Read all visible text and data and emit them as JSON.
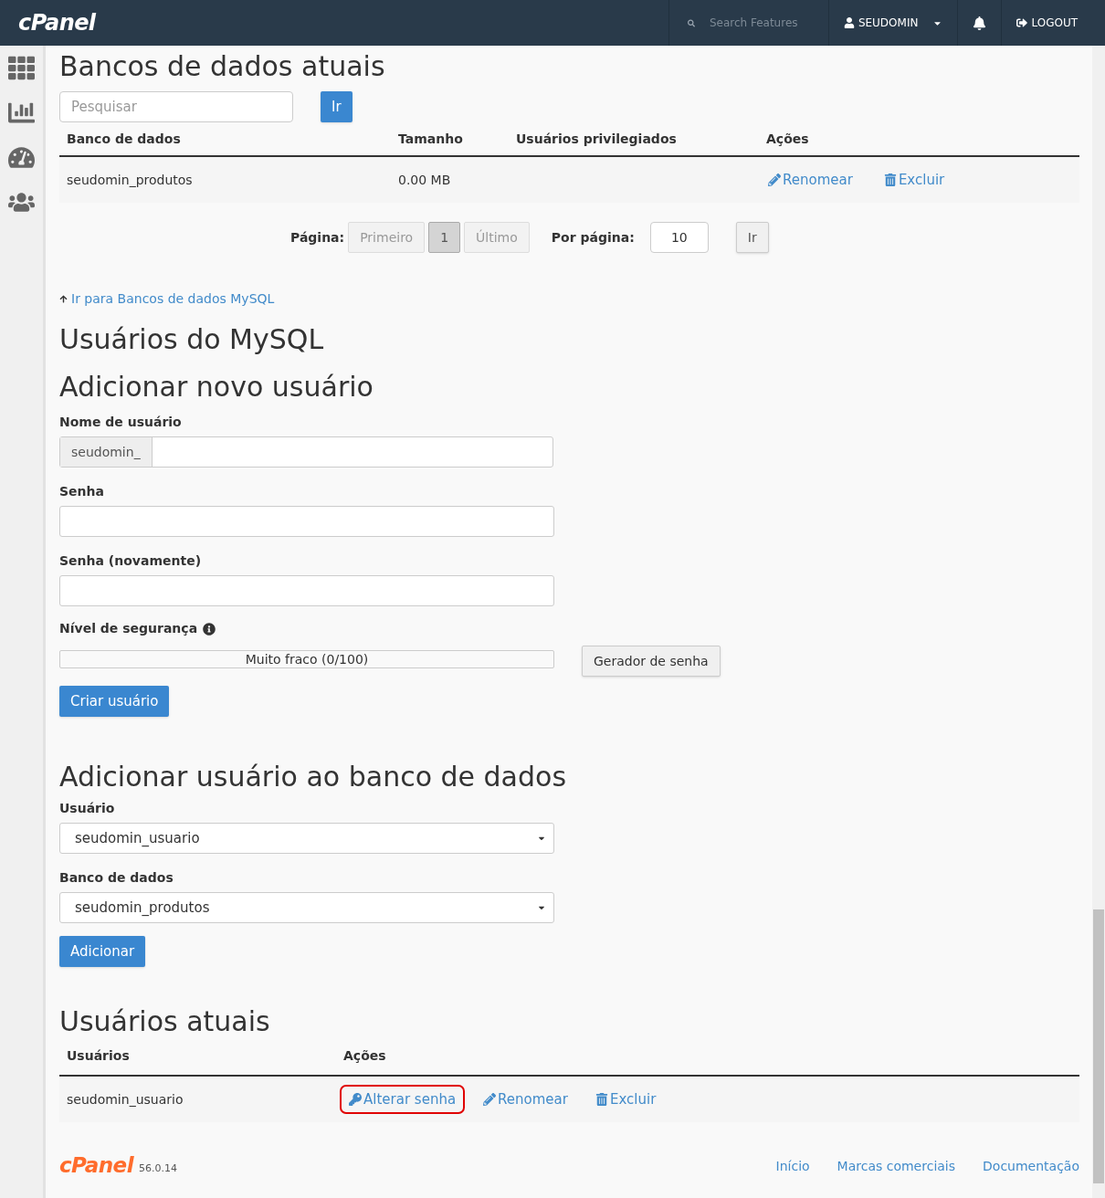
{
  "topbar": {
    "logo": "cPanel",
    "search": {
      "placeholder": "Search Features"
    },
    "user": "SEUDOMIN",
    "logout": "LOGOUT"
  },
  "databases": {
    "title": "Bancos de dados atuais",
    "search": {
      "placeholder": "Pesquisar"
    },
    "go": "Ir",
    "columns": [
      "Banco de dados",
      "Tamanho",
      "Usuários privilegiados",
      "Ações"
    ],
    "rows": [
      {
        "name": "seudomin_produtos",
        "size": "0.00 MB",
        "users": "",
        "actions": [
          {
            "kind": "rename",
            "label": "Renomear"
          },
          {
            "kind": "delete",
            "label": "Excluir"
          }
        ]
      }
    ],
    "pagination": {
      "label": "Página:",
      "pages": [
        {
          "label": "Primeiro",
          "selected": false
        },
        {
          "label": "1",
          "selected": true
        },
        {
          "label": "Último",
          "selected": false
        }
      ],
      "per_page_label": "Por página:",
      "per_page": "10",
      "go": "Ir"
    },
    "back_link": "Ir para Bancos de dados MySQL"
  },
  "users_title": "Usuários do MySQL",
  "add_user": {
    "title": "Adicionar novo usuário",
    "username_label": "Nome de usuário",
    "prefix": "seudomin_",
    "password_label": "Senha",
    "password2_label": "Senha (novamente)",
    "strength_label": "Nível de segurança",
    "strength": {
      "level": 0,
      "reading": "Muito fraco (0/100)"
    },
    "generator": "Gerador de senha",
    "submit": "Criar usuário"
  },
  "add_to_db": {
    "title": "Adicionar usuário ao banco de dados",
    "user_label": "Usuário",
    "user": "seudomin_usuario",
    "db_label": "Banco de dados",
    "db": "seudomin_produtos",
    "submit": "Adicionar"
  },
  "current_users": {
    "title": "Usuários atuais",
    "columns": [
      "Usuários",
      "Ações"
    ],
    "rows": [
      {
        "name": "seudomin_usuario",
        "actions": [
          {
            "kind": "password",
            "label": "Alterar senha",
            "highlighted": true
          },
          {
            "kind": "rename",
            "label": "Renomear",
            "highlighted": false
          },
          {
            "kind": "delete",
            "label": "Excluir",
            "highlighted": false
          }
        ]
      }
    ]
  },
  "footer": {
    "logo": "cPanel",
    "version": "56.0.14",
    "links": [
      "Início",
      "Marcas comerciais",
      "Documentação"
    ]
  }
}
